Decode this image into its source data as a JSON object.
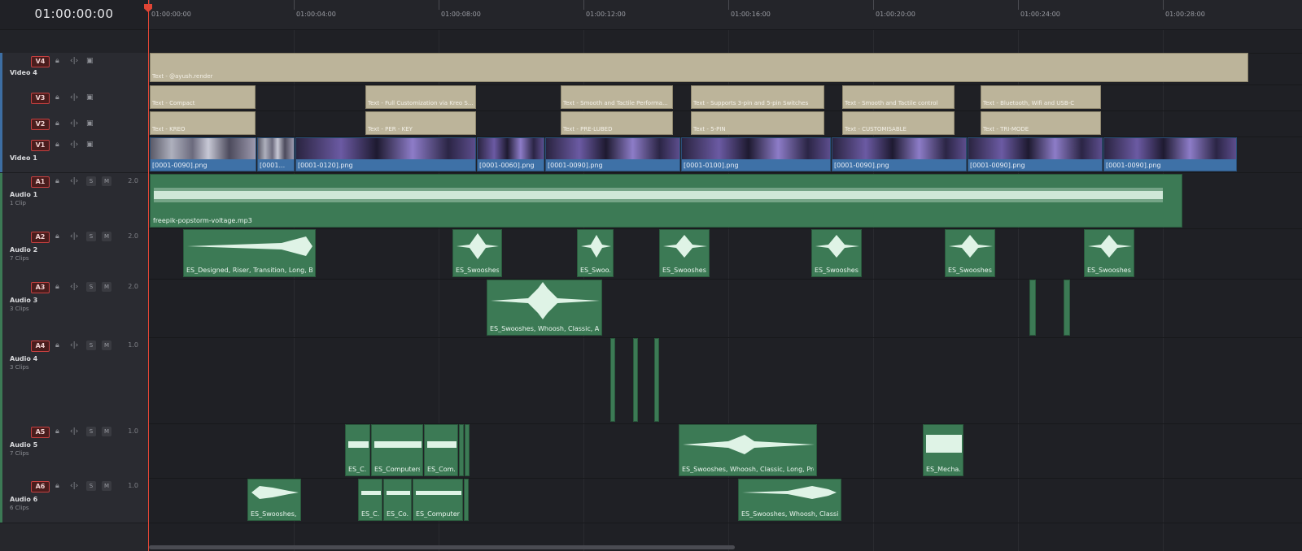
{
  "header": {
    "timecode": "01:00:00:00"
  },
  "ruler": {
    "labels": [
      "01:00:00:00",
      "01:00:04:00",
      "01:00:08:00",
      "01:00:12:00",
      "01:00:16:00",
      "01:00:20:00",
      "01:00:24:00",
      "01:00:28:00"
    ]
  },
  "tracks": {
    "v4": {
      "id": "V4",
      "name": "Video 4"
    },
    "v3": {
      "id": "V3"
    },
    "v2": {
      "id": "V2"
    },
    "v1": {
      "id": "V1",
      "name": "Video 1"
    },
    "a1": {
      "id": "A1",
      "name": "Audio 1",
      "sub": "1 Clip",
      "gain": "2.0"
    },
    "a2": {
      "id": "A2",
      "name": "Audio 2",
      "sub": "7 Clips",
      "gain": "2.0"
    },
    "a3": {
      "id": "A3",
      "name": "Audio 3",
      "sub": "3 Clips",
      "gain": "2.0"
    },
    "a4": {
      "id": "A4",
      "name": "Audio 4",
      "sub": "3 Clips",
      "gain": "1.0"
    },
    "a5": {
      "id": "A5",
      "name": "Audio 5",
      "sub": "7 Clips",
      "gain": "1.0"
    },
    "a6": {
      "id": "A6",
      "name": "Audio 6",
      "sub": "6 Clips",
      "gain": "1.0"
    }
  },
  "solo_label": "S",
  "mute_label": "M",
  "clips": {
    "v4": [
      "Text - @ayush.render"
    ],
    "v3": [
      "Text - Compact",
      "Text - Full Customization via Kreo S...",
      "Text - Smooth and Tactile Performa...",
      "Text - Supports 3-pin and 5-pin Switches",
      "Text - Smooth and Tactile control",
      "Text - Bluetooth, Wifi and USB-C"
    ],
    "v2": [
      "Text - KREO",
      "Text - PER - KEY",
      "Text - PRE-LUBED",
      "Text - 5-PIN",
      "Text - CUSTOMISABLE",
      "Text - TRI-MODE"
    ],
    "v1": [
      "[0001-0090].png",
      "[0001...",
      "[0001-0120].png",
      "[0001-0060].png",
      "[0001-0090].png",
      "[0001-0100].png",
      "[0001-0090].png",
      "[0001-0090].png",
      "[0001-0090].png"
    ],
    "a1": [
      "freepik-popstorm-voltage.mp3"
    ],
    "a2": [
      "ES_Designed, Riser, Transition, Long, Build ...",
      "ES_Swooshes,...",
      "ES_Swoo...",
      "ES_Swooshes,...",
      "ES_Swooshes,...",
      "ES_Swooshes,...",
      "ES_Swooshes,..."
    ],
    "a3": [
      "ES_Swooshes, Whoosh, Classic, Airy ..."
    ],
    "a5": [
      "ES_C...",
      "ES_Computers...",
      "ES_Com...",
      "ES_Swooshes, Whoosh, Classic, Long, Proces...",
      "ES_Mecha..."
    ],
    "a6": [
      "ES_Swooshes, ...",
      "ES_C...",
      "ES_Co...",
      "ES_Computers...",
      "ES_Swooshes, Whoosh, Classic, ..."
    ]
  },
  "colors": {
    "text_clip": "#bcb49a",
    "video_clip": "#3e71a7",
    "audio_clip": "#3c7a55",
    "playhead": "#e04535",
    "track_badge": "#c64040"
  }
}
